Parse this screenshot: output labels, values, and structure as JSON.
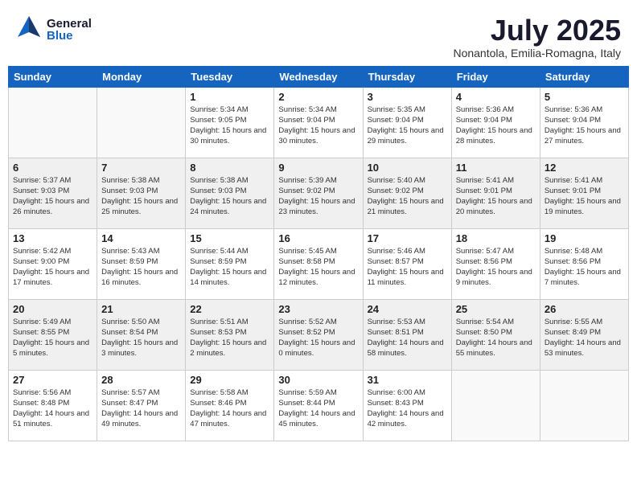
{
  "header": {
    "logo_general": "General",
    "logo_blue": "Blue",
    "month_title": "July 2025",
    "location": "Nonantola, Emilia-Romagna, Italy"
  },
  "weekdays": [
    "Sunday",
    "Monday",
    "Tuesday",
    "Wednesday",
    "Thursday",
    "Friday",
    "Saturday"
  ],
  "weeks": [
    [
      {
        "day": "",
        "info": ""
      },
      {
        "day": "",
        "info": ""
      },
      {
        "day": "1",
        "info": "Sunrise: 5:34 AM\nSunset: 9:05 PM\nDaylight: 15 hours and 30 minutes."
      },
      {
        "day": "2",
        "info": "Sunrise: 5:34 AM\nSunset: 9:04 PM\nDaylight: 15 hours and 30 minutes."
      },
      {
        "day": "3",
        "info": "Sunrise: 5:35 AM\nSunset: 9:04 PM\nDaylight: 15 hours and 29 minutes."
      },
      {
        "day": "4",
        "info": "Sunrise: 5:36 AM\nSunset: 9:04 PM\nDaylight: 15 hours and 28 minutes."
      },
      {
        "day": "5",
        "info": "Sunrise: 5:36 AM\nSunset: 9:04 PM\nDaylight: 15 hours and 27 minutes."
      }
    ],
    [
      {
        "day": "6",
        "info": "Sunrise: 5:37 AM\nSunset: 9:03 PM\nDaylight: 15 hours and 26 minutes."
      },
      {
        "day": "7",
        "info": "Sunrise: 5:38 AM\nSunset: 9:03 PM\nDaylight: 15 hours and 25 minutes."
      },
      {
        "day": "8",
        "info": "Sunrise: 5:38 AM\nSunset: 9:03 PM\nDaylight: 15 hours and 24 minutes."
      },
      {
        "day": "9",
        "info": "Sunrise: 5:39 AM\nSunset: 9:02 PM\nDaylight: 15 hours and 23 minutes."
      },
      {
        "day": "10",
        "info": "Sunrise: 5:40 AM\nSunset: 9:02 PM\nDaylight: 15 hours and 21 minutes."
      },
      {
        "day": "11",
        "info": "Sunrise: 5:41 AM\nSunset: 9:01 PM\nDaylight: 15 hours and 20 minutes."
      },
      {
        "day": "12",
        "info": "Sunrise: 5:41 AM\nSunset: 9:01 PM\nDaylight: 15 hours and 19 minutes."
      }
    ],
    [
      {
        "day": "13",
        "info": "Sunrise: 5:42 AM\nSunset: 9:00 PM\nDaylight: 15 hours and 17 minutes."
      },
      {
        "day": "14",
        "info": "Sunrise: 5:43 AM\nSunset: 8:59 PM\nDaylight: 15 hours and 16 minutes."
      },
      {
        "day": "15",
        "info": "Sunrise: 5:44 AM\nSunset: 8:59 PM\nDaylight: 15 hours and 14 minutes."
      },
      {
        "day": "16",
        "info": "Sunrise: 5:45 AM\nSunset: 8:58 PM\nDaylight: 15 hours and 12 minutes."
      },
      {
        "day": "17",
        "info": "Sunrise: 5:46 AM\nSunset: 8:57 PM\nDaylight: 15 hours and 11 minutes."
      },
      {
        "day": "18",
        "info": "Sunrise: 5:47 AM\nSunset: 8:56 PM\nDaylight: 15 hours and 9 minutes."
      },
      {
        "day": "19",
        "info": "Sunrise: 5:48 AM\nSunset: 8:56 PM\nDaylight: 15 hours and 7 minutes."
      }
    ],
    [
      {
        "day": "20",
        "info": "Sunrise: 5:49 AM\nSunset: 8:55 PM\nDaylight: 15 hours and 5 minutes."
      },
      {
        "day": "21",
        "info": "Sunrise: 5:50 AM\nSunset: 8:54 PM\nDaylight: 15 hours and 3 minutes."
      },
      {
        "day": "22",
        "info": "Sunrise: 5:51 AM\nSunset: 8:53 PM\nDaylight: 15 hours and 2 minutes."
      },
      {
        "day": "23",
        "info": "Sunrise: 5:52 AM\nSunset: 8:52 PM\nDaylight: 15 hours and 0 minutes."
      },
      {
        "day": "24",
        "info": "Sunrise: 5:53 AM\nSunset: 8:51 PM\nDaylight: 14 hours and 58 minutes."
      },
      {
        "day": "25",
        "info": "Sunrise: 5:54 AM\nSunset: 8:50 PM\nDaylight: 14 hours and 55 minutes."
      },
      {
        "day": "26",
        "info": "Sunrise: 5:55 AM\nSunset: 8:49 PM\nDaylight: 14 hours and 53 minutes."
      }
    ],
    [
      {
        "day": "27",
        "info": "Sunrise: 5:56 AM\nSunset: 8:48 PM\nDaylight: 14 hours and 51 minutes."
      },
      {
        "day": "28",
        "info": "Sunrise: 5:57 AM\nSunset: 8:47 PM\nDaylight: 14 hours and 49 minutes."
      },
      {
        "day": "29",
        "info": "Sunrise: 5:58 AM\nSunset: 8:46 PM\nDaylight: 14 hours and 47 minutes."
      },
      {
        "day": "30",
        "info": "Sunrise: 5:59 AM\nSunset: 8:44 PM\nDaylight: 14 hours and 45 minutes."
      },
      {
        "day": "31",
        "info": "Sunrise: 6:00 AM\nSunset: 8:43 PM\nDaylight: 14 hours and 42 minutes."
      },
      {
        "day": "",
        "info": ""
      },
      {
        "day": "",
        "info": ""
      }
    ]
  ]
}
